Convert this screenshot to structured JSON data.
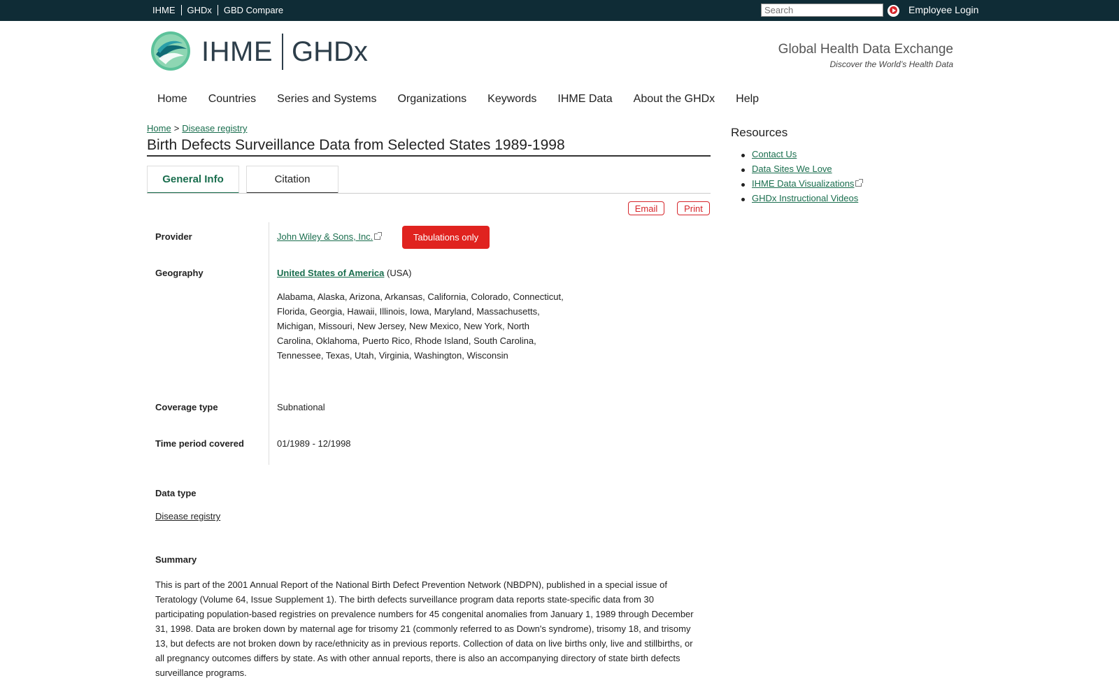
{
  "topbar": {
    "links": [
      "IHME",
      "GHDx",
      "GBD Compare"
    ],
    "search_placeholder": "Search",
    "employee_login": "Employee Login"
  },
  "header": {
    "brand_left": "IHME",
    "brand_right": "GHDx",
    "tagline_title": "Global Health Data Exchange",
    "tagline_sub": "Discover the World’s Health Data"
  },
  "nav": [
    "Home",
    "Countries",
    "Series and Systems",
    "Organizations",
    "Keywords",
    "IHME Data",
    "About the GHDx",
    "Help"
  ],
  "breadcrumb": {
    "home": "Home",
    "sep": ">",
    "current": "Disease registry"
  },
  "page_title": "Birth Defects Surveillance Data from Selected States 1989-1998",
  "tabs": {
    "general_info": "General Info",
    "citation": "Citation"
  },
  "actions": {
    "email": "Email",
    "print": "Print"
  },
  "details": {
    "provider_label": "Provider",
    "provider_value": "John Wiley & Sons, Inc.",
    "provider_badge": "Tabulations only",
    "geography_label": "Geography",
    "geography_country": "United States of America",
    "geography_code": "(USA)",
    "geography_states": "Alabama, Alaska, Arizona, Arkansas, California, Colorado, Connecticut, Florida, Georgia, Hawaii, Illinois, Iowa, Maryland, Massachusetts, Michigan, Missouri, New Jersey, New Mexico, New York, North Carolina, Oklahoma, Puerto Rico, Rhode Island, South Carolina, Tennessee, Texas, Utah, Virginia, Washington, Wisconsin",
    "coverage_label": "Coverage type",
    "coverage_value": "Subnational",
    "time_label": "Time period covered",
    "time_value": "01/1989 - 12/1998",
    "data_type_label": "Data type",
    "data_type_value": "Disease registry",
    "summary_label": "Summary",
    "summary_text": "This is part of the 2001 Annual Report of the National Birth Defect Prevention Network (NBDPN), published in a special issue of Teratology (Volume 64, Issue Supplement 1). The birth defects surveillance program data reports state-specific data from 30 participating population-based registries on prevalence numbers for 45 congenital anomalies from January 1, 1989 through December 31, 1998. Data are broken down by maternal age for trisomy 21 (commonly referred to as Down's syndrome), trisomy 18, and trisomy 13, but defects are not broken down by race/ethnicity as in previous reports. Collection of data on live births only, live and stillbirths, or all pregnancy outcomes differs by state. As with other annual reports, there is also an accompanying directory of state birth defects surveillance programs."
  },
  "sidebar": {
    "title": "Resources",
    "items": [
      "Contact Us",
      "Data Sites We Love",
      "IHME Data Visualizations",
      "GHDx Instructional Videos"
    ]
  },
  "colors": {
    "topbar": "#0f2c36",
    "link": "#1a6e4e",
    "accent_red": "#e0231f"
  }
}
